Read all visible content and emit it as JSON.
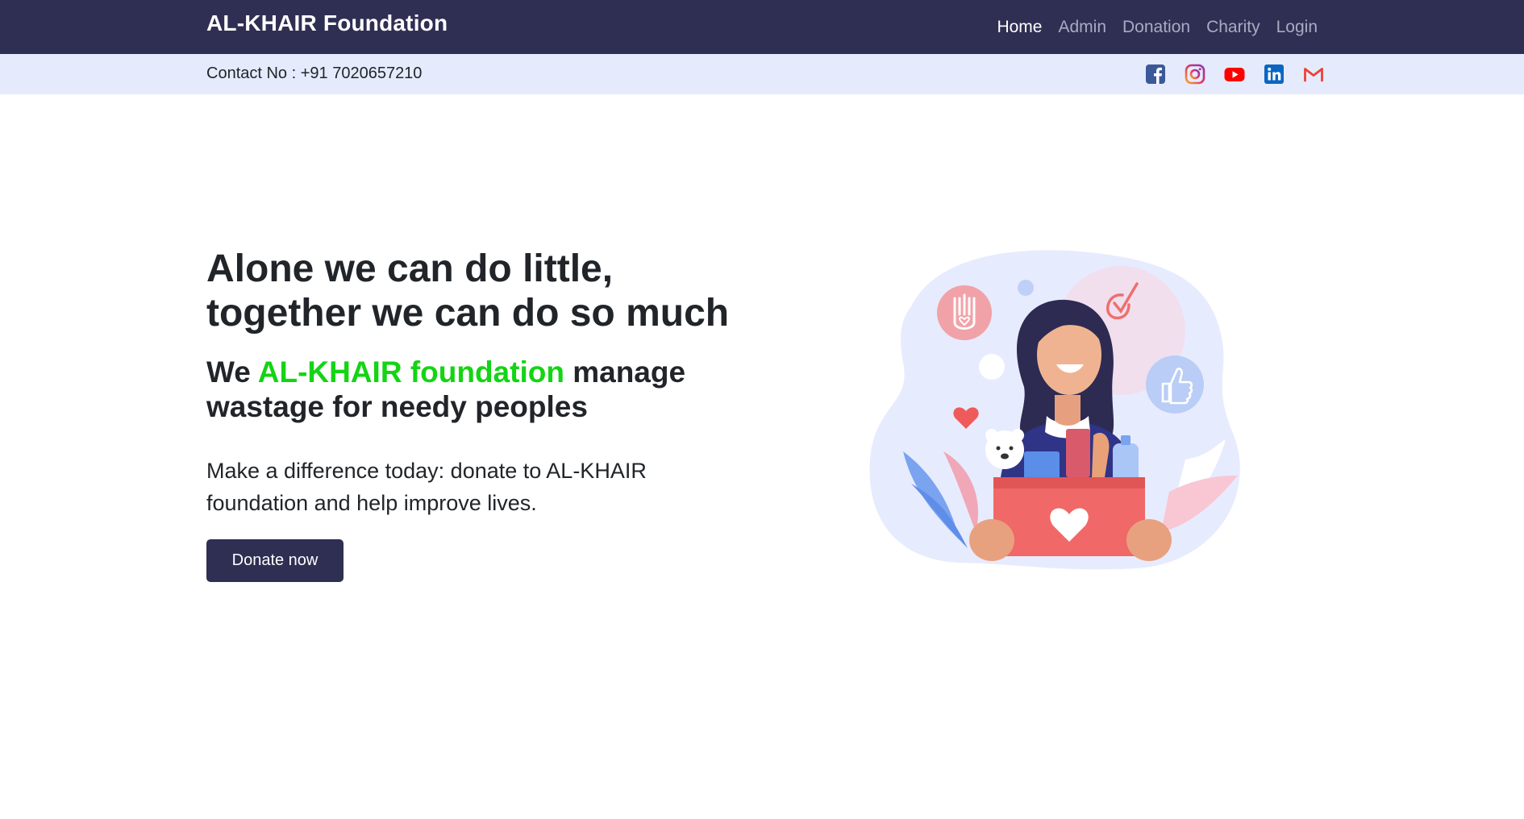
{
  "nav": {
    "brand": "AL-KHAIR Foundation",
    "links": [
      "Home",
      "Admin",
      "Donation",
      "Charity",
      "Login"
    ],
    "active": "Home"
  },
  "contact": {
    "text": "Contact No : +91 7020657210",
    "socials": [
      "facebook-icon",
      "instagram-icon",
      "youtube-icon",
      "linkedin-icon",
      "gmail-icon"
    ]
  },
  "hero": {
    "title_line1": "Alone we can do little,",
    "title_line2": "together we can do so much",
    "sub_prefix": "We ",
    "sub_accent": "AL-KHAIR foundation",
    "sub_suffix": " manage wastage for needy peoples",
    "text": "Make a difference today: donate to AL-KHAIR foundation and help improve lives.",
    "button": "Donate now"
  },
  "colors": {
    "navbar": "#2f2f53",
    "contact_bar": "#e5ebfc",
    "accent": "#14d414",
    "button": "#2f2f53"
  }
}
